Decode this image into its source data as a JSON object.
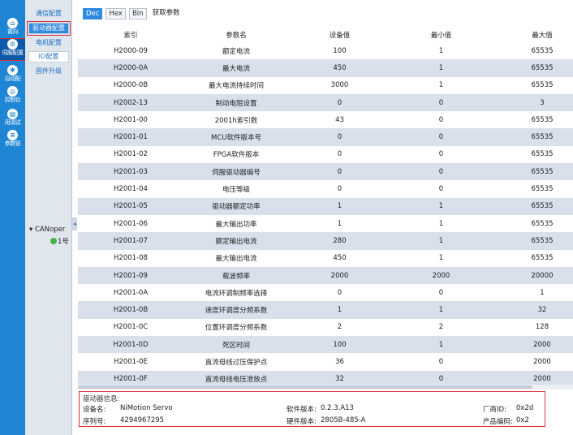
{
  "rail": {
    "items": [
      {
        "label": "置向",
        "icon": "home-icon",
        "glyph": "⌂"
      },
      {
        "label": "伺服配置",
        "icon": "servo-config-icon",
        "glyph": "⚙"
      },
      {
        "label": "自动配",
        "icon": "auto-config-icon",
        "glyph": "✱"
      },
      {
        "label": "控制台",
        "icon": "control-icon",
        "glyph": "◎"
      },
      {
        "label": "用调试",
        "icon": "debug-icon",
        "glyph": "▤"
      },
      {
        "label": "参数管",
        "icon": "param-icon",
        "glyph": "≡"
      }
    ]
  },
  "submenu": {
    "items": [
      "通信配置",
      "驱动器配置",
      "电机配置",
      "IO配置",
      "固件升级"
    ],
    "tree_node": "CANoper",
    "tree_child": "1号"
  },
  "toolbar": {
    "dec": "Dec",
    "hex": "Hex",
    "bin": "Bin",
    "fetch": "获取参数"
  },
  "table": {
    "headers": [
      "索引",
      "参数名",
      "设备值",
      "最小值",
      "最大值"
    ],
    "rows": [
      [
        "H2000-09",
        "额定电流",
        "100",
        "1",
        "65535"
      ],
      [
        "H2000-0A",
        "最大电流",
        "450",
        "1",
        "65535"
      ],
      [
        "H2000-0B",
        "最大电流持续时间",
        "3000",
        "1",
        "65535"
      ],
      [
        "H2002-13",
        "制动电阻设置",
        "0",
        "0",
        "3"
      ],
      [
        "H2001-00",
        "2001h索引数",
        "43",
        "0",
        "65535"
      ],
      [
        "H2001-01",
        "MCU软件版本号",
        "0",
        "0",
        "65535"
      ],
      [
        "H2001-02",
        "FPGA软件版本",
        "0",
        "0",
        "65535"
      ],
      [
        "H2001-03",
        "伺服驱动器编号",
        "0",
        "0",
        "65535"
      ],
      [
        "H2001-04",
        "电压等级",
        "0",
        "0",
        "65535"
      ],
      [
        "H2001-05",
        "驱动器额定功率",
        "1",
        "1",
        "65535"
      ],
      [
        "H2001-06",
        "最大输出功率",
        "1",
        "1",
        "65535"
      ],
      [
        "H2001-07",
        "额定输出电流",
        "280",
        "1",
        "65535"
      ],
      [
        "H2001-08",
        "最大输出电流",
        "450",
        "1",
        "65535"
      ],
      [
        "H2001-09",
        "载波频率",
        "2000",
        "2000",
        "20000"
      ],
      [
        "H2001-0A",
        "电流环调制频率选择",
        "0",
        "0",
        "1"
      ],
      [
        "H2001-0B",
        "速度环调度分频系数",
        "1",
        "1",
        "32"
      ],
      [
        "H2001-0C",
        "位置环调度分频系数",
        "2",
        "2",
        "128"
      ],
      [
        "H2001-0D",
        "死区时间",
        "100",
        "1",
        "2000"
      ],
      [
        "H2001-0E",
        "直流母线过压保护点",
        "36",
        "0",
        "2000"
      ],
      [
        "H2001-0F",
        "直流母线电压泄放点",
        "32",
        "0",
        "2000"
      ]
    ]
  },
  "info": {
    "title": "驱动器信息:",
    "device_name_label": "设备名:",
    "device_name": "NiMotion Servo",
    "serial_label": "序列号:",
    "serial": "4294967295",
    "sw_label": "软件版本:",
    "sw": "0.2.3.A13",
    "hw_label": "硬件版本:",
    "hw": "2805B-485-A",
    "vendor_label": "厂商ID:",
    "vendor": "0x2d",
    "product_label": "产品编码:",
    "product": "0x2"
  },
  "colors": {
    "accent": "#2f8ae0",
    "rail": "#1f86d6",
    "highlight": "#d9303a",
    "row_alt": "#d8e0ec"
  }
}
